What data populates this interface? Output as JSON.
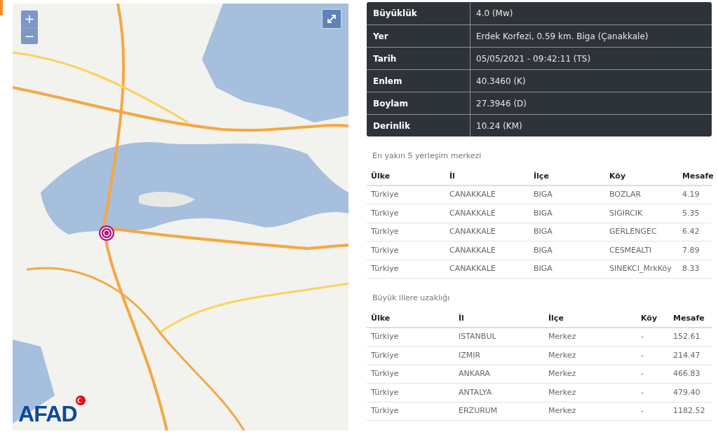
{
  "map": {
    "zoom_in": "+",
    "zoom_out": "−",
    "logo": "AFAD"
  },
  "details": [
    {
      "label": "Büyüklük",
      "value": "4.0 (Mw)"
    },
    {
      "label": "Yer",
      "value": "Erdek Korfezi, 0.59 km. Biga (Çanakkale)"
    },
    {
      "label": "Tarih",
      "value": "05/05/2021 - 09:42:11 (TS)"
    },
    {
      "label": "Enlem",
      "value": "40.3460 (K)"
    },
    {
      "label": "Boylam",
      "value": "27.3946 (D)"
    },
    {
      "label": "Derinlik",
      "value": "10.24 (KM)"
    }
  ],
  "nearest": {
    "title": "En yakın 5 yerleşim merkezi",
    "columns": [
      "Ülke",
      "İl",
      "İlçe",
      "Köy",
      "Mesafe"
    ],
    "rows": [
      [
        "Türkiye",
        "CANAKKALE",
        "BIGA",
        "BOZLAR",
        "4.19"
      ],
      [
        "Türkiye",
        "CANAKKALE",
        "BIGA",
        "SIGIRCIK",
        "5.35"
      ],
      [
        "Türkiye",
        "CANAKKALE",
        "BIGA",
        "GERLENGEC",
        "6.42"
      ],
      [
        "Türkiye",
        "CANAKKALE",
        "BIGA",
        "CESMEALTI",
        "7.89"
      ],
      [
        "Türkiye",
        "CANAKKALE",
        "BIGA",
        "SINEKCI_MrkKöy",
        "8.33"
      ]
    ]
  },
  "cities": {
    "title": "Büyük illere uzaklığı",
    "columns": [
      "Ülke",
      "İl",
      "İlçe",
      "Köy",
      "Mesafe"
    ],
    "rows": [
      [
        "Türkiye",
        "ISTANBUL",
        "Merkez",
        "-",
        "152.61"
      ],
      [
        "Türkiye",
        "IZMIR",
        "Merkez",
        "-",
        "214.47"
      ],
      [
        "Türkiye",
        "ANKARA",
        "Merkez",
        "-",
        "466.83"
      ],
      [
        "Türkiye",
        "ANTALYA",
        "Merkez",
        "-",
        "479.40"
      ],
      [
        "Türkiye",
        "ERZURUM",
        "Merkez",
        "-",
        "1182.52"
      ]
    ]
  }
}
